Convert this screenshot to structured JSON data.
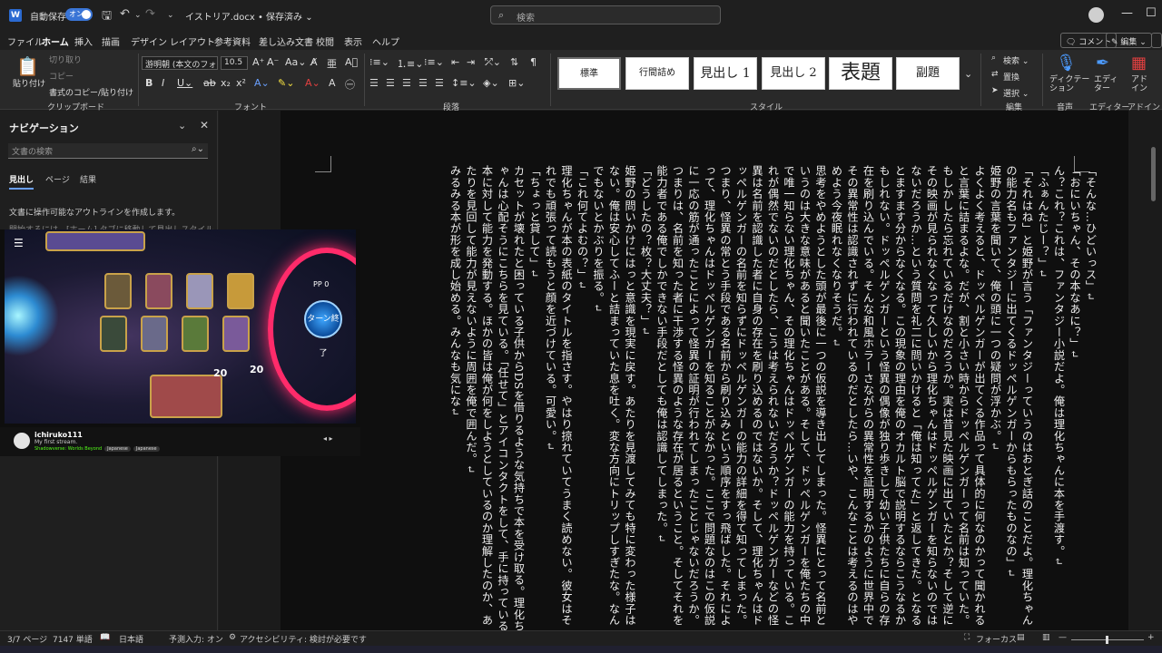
{
  "titlebar": {
    "app_icon": "word-icon",
    "autosave_label": "自動保存",
    "autosave_state": "オン",
    "doc_title": "イストリア.docx • 保存済み ⌄",
    "search_placeholder": "検索"
  },
  "menu": {
    "tabs": [
      "ファイル",
      "ホーム",
      "挿入",
      "描画",
      "デザイン",
      "レイアウト",
      "参考資料",
      "差し込み文書",
      "校閲",
      "表示",
      "ヘルプ"
    ],
    "active": "ホーム",
    "comment_label": "コメント",
    "edit_label": "編集 ⌄"
  },
  "ribbon": {
    "clipboard": {
      "paste": "貼り付け",
      "cut": "切り取り",
      "copy": "コピー",
      "format_painter": "書式のコピー/貼り付け",
      "label": "クリップボード"
    },
    "font": {
      "font_name": "游明朝 (本文のフォン",
      "font_size": "10.5",
      "label": "フォント"
    },
    "paragraph": {
      "label": "段落"
    },
    "styles": {
      "items": [
        "標準",
        "行間詰め",
        "見出し 1",
        "見出し 2",
        "表題",
        "副題"
      ],
      "label": "スタイル"
    },
    "editing": {
      "find": "検索 ⌄",
      "replace": "置換",
      "select": "選択 ⌄",
      "label": "編集"
    },
    "voice": {
      "dictate": "ディクテー\nション",
      "label": "音声"
    },
    "editor": {
      "name": "エディ\nター",
      "label": "エディター"
    },
    "addins": {
      "name": "アド\nイン",
      "label": "アドイン"
    }
  },
  "nav": {
    "title": "ナビゲーション",
    "search_placeholder": "文書の検索",
    "tabs": [
      "見出し",
      "ページ",
      "結果"
    ],
    "hint": "文書に操作可能なアウトラインを作成します。",
    "hint2": "開始するには、[ホーム] タブに移動して見出しスタイルを適用します。"
  },
  "document": {
    "paragraphs": [
      "「そんな…ひどいっス」",
      "「おにいちゃん、その本なあに？」",
      "ん？これ？これは、ファンタジー小説だよ。俺は理化ちゃんに本を手渡す。",
      "「ふぁんたじー？」",
      "「それはね」と姫野が言う「ファンタジーっていうのはおとぎ話のことだよ。理化ちゃんの能力名もファンタジーに出てくるドッペルゲンガーからもらったものなの」",
      "姫野の言葉を聞いて、俺の頭に一つの疑問が浮かぶ。",
      "よくよく考えると、ドッペルゲンガーが出てくる作品って具体的に何なのかって聞かれると言葉に詰まるよな。だが、割と小さい時からドッペルゲンガーって名前は知っていた。もしかしたら忘れているだけなのだろうか。実は昔見た映画に出ていたとか？そして逆にその映画が見られなくなって久しいから理化ちゃんはドッペルゲンガーを知らないのではないだろうか…という質問を礼二に問いかけると「俺は知ってた」と返してきた。となるとますます分からなくなる。この現象の理由を俺のオカルト脳で説明するならこうなるかもしれない。ドッペルゲンガーという怪異の偶像が独り歩きして幼い子供たちに自らの存在を刷り込んでいる。そんな和風ホラーさながらの異常性を証明するかのように世界中でその異常性は認識されずに行われているのだとしたら…いや、こんなことは考えるのはやめよう今夜眠れなくなりそうだ。",
      "思考をやめようとした頭が最後に一つの仮説を導き出してしまった。怪異にとって名前というのは大きな意味があると聞いたことがある。そして、ドッペルゲンガーを俺たちの中で唯一知らない理化ちゃん、その理化ちゃんはドッペルゲンガーの能力を持っている。これが偶然でないのだとしたら、こうは考えられないだろうか？ドッペルゲンガーなどの怪異は名前を認識した者に自身の存在を刷り込めるのではないか。そして、理化ちゃんはドッペルゲンガーの名前を知らずにドッペルゲンガーの能力の詳細を得て知ってしまった。つまり、怪異の常とう手段である名前から刷り込みという順序をすっ飛ばした。それによって、理化ちゃんはドッペルゲンガーを知ることがなかった。ここで問題なのはこの仮説に一応の筋が通ったことによって怪異の証明が行われてしまったことじゃないだろうか。つまりは、名前を知った者に干渉する怪異のような存在が居るということ。そしてそれを能力者である俺でしかできない手段だとしても俺は認識してしまった。",
      "「どうしたの？枚？大丈夫？」",
      "姫野の問いかけにはっと意識を現実に戻す。あたりを見渡してみても特に変わった様子はない。俺は安心してふーと詰まっていた息を吐く。変な方向にトリップしすぎたな。なんでもないとかぶりを振る。",
      "「これ何てよむの？」",
      "理化ちゃんが本の表紙のタイトルを指さす。やはり掠れていてうまく読めない。彼女はそれでも頑張って読もうと顔を近づけている。可愛い。",
      "「ちょっと貸して」",
      "カセットが壊れたと困っている子供からDSを借りるような気持ちで本を受け取る。理化ちゃんは心配そうにこちらを見ている。「任せて」とアイコンタクトをして、手に持っている本に対して能力を発動する。ほかの皆は俺が何をしようとしているのか理解したのか、あたりを見回して能力が見えないように周囲を俺で囲んだ。",
      "みるみる本が形を成し始める。みんなも気にな"
    ]
  },
  "video": {
    "turn_label": "ターン終了",
    "pp_label": "PP",
    "pp_value": "0",
    "channel": "ichiruko111",
    "stream_title": "My first stream.",
    "tags": [
      "Shadowverse: Worlds Beyond",
      "Japanese",
      "Japanese"
    ],
    "life_me": "20",
    "life_opponent": "20"
  },
  "status": {
    "page": "3/7 ページ",
    "words": "7147 単語",
    "language": "日本語",
    "predict": "予測入力: オン",
    "accessibility": "アクセシビリティ: 検討が必要です",
    "focus": "フォーカス"
  },
  "colors": {
    "accent": "#2b6ad1",
    "background": "#1f1f1f",
    "page": "#0f0f0f"
  }
}
